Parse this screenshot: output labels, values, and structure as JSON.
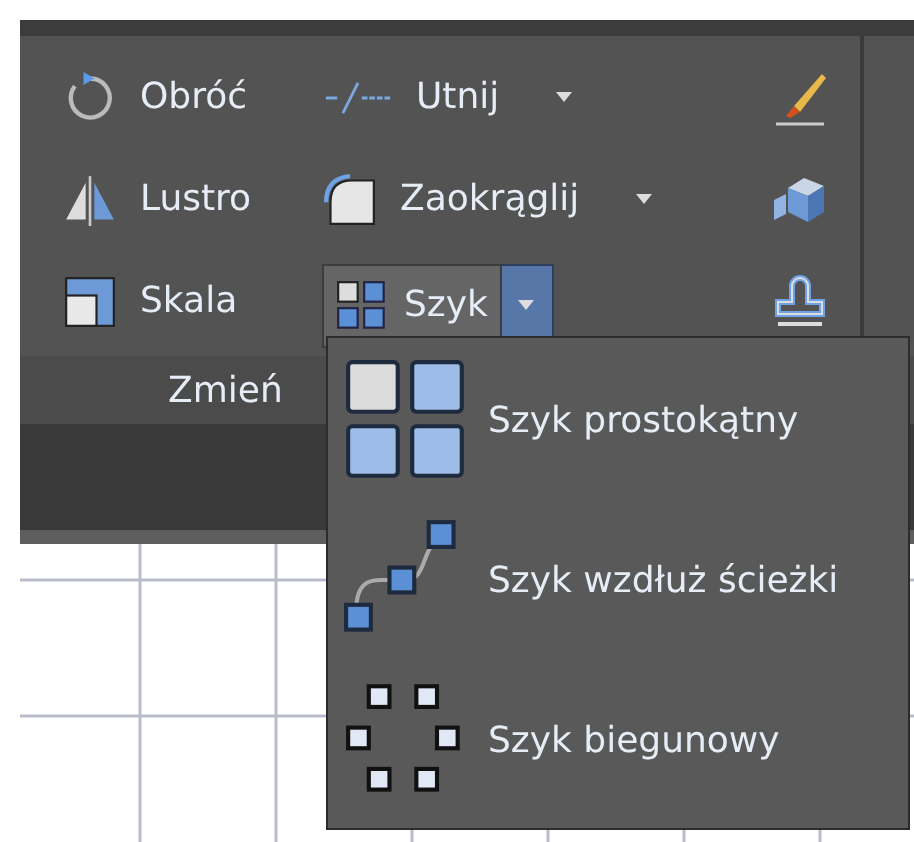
{
  "ribbon": {
    "tools": [
      {
        "label": "Obróć",
        "has_menu": false
      },
      {
        "label": "Utnij",
        "has_menu": true
      },
      {
        "label": "Lustro",
        "has_menu": false
      },
      {
        "label": "Zaokrąglij",
        "has_menu": true
      },
      {
        "label": "Skala",
        "has_menu": false
      },
      {
        "label": "Szyk",
        "has_menu": true,
        "expanded": true
      }
    ],
    "panel_title": "Zmień"
  },
  "dropdown": {
    "items": [
      {
        "label": "Szyk prostokątny"
      },
      {
        "label": "Szyk wzdłuż ścieżki"
      },
      {
        "label": "Szyk biegunowy"
      }
    ]
  }
}
